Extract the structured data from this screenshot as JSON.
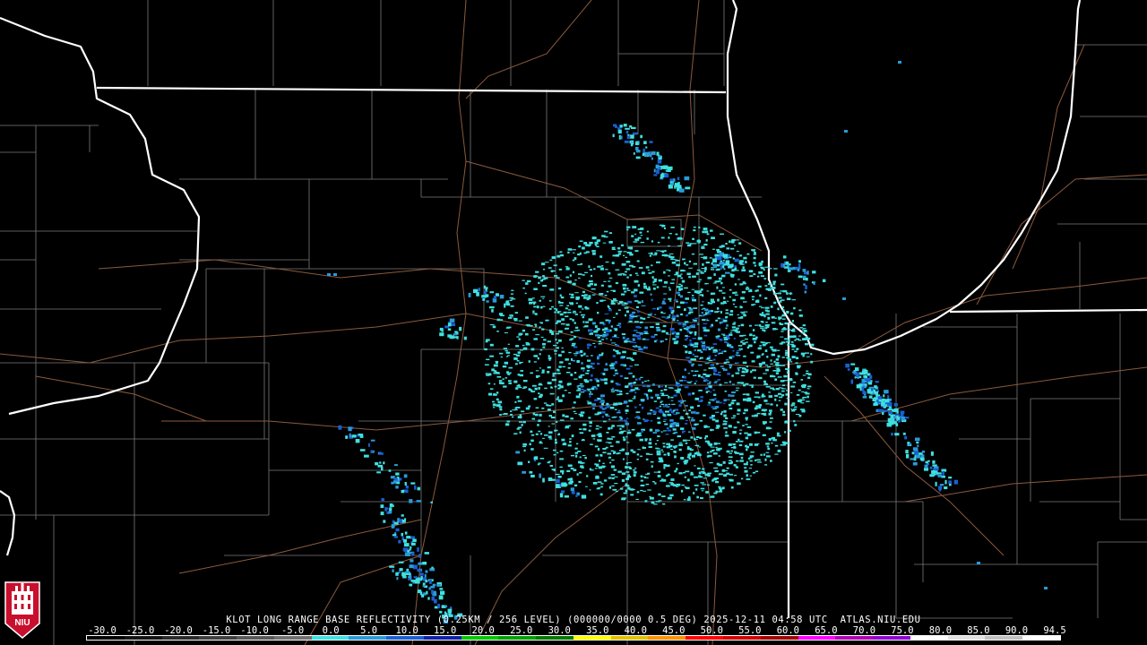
{
  "product_caption": "KLOT LONG RANGE BASE REFLECTIVITY (0.25KM / 256 LEVEL) (000000/0000 0.5 DEG) 2025-12-11 04:58 UTC  ATLAS.NIU.EDU",
  "logo_text": "NIU",
  "colorbar": {
    "labels": [
      "-30.0",
      "-25.0",
      "-20.0",
      "-15.0",
      "-10.0",
      "-5.0",
      "0.0",
      "5.0",
      "10.0",
      "15.0",
      "20.0",
      "25.0",
      "30.0",
      "35.0",
      "40.0",
      "45.0",
      "50.0",
      "55.0",
      "60.0",
      "65.0",
      "70.0",
      "75.0",
      "80.0",
      "85.0",
      "90.0",
      "94.5"
    ],
    "colors": [
      "#000000",
      "#141414",
      "#2a2a2a",
      "#404040",
      "#585858",
      "#707070",
      "#40e0e0",
      "#2a9ad8",
      "#1a5fd0",
      "#1020a8",
      "#00c800",
      "#00a000",
      "#007800",
      "#ffff00",
      "#e0c000",
      "#ff9000",
      "#ff0000",
      "#d00000",
      "#a00000",
      "#ff00ff",
      "#b000b0",
      "#9000d0",
      "#ffffff",
      "#e0e0e0",
      "#c0c0c0",
      "#ffffff"
    ]
  },
  "colors": {
    "state_border": "#ffffff",
    "county_line": "#7a7a7a",
    "highway": "#8b5a3c",
    "echo_light": "#3fe0e0",
    "echo_mid": "#2a9ad8",
    "echo_dark": "#1a5fd0"
  }
}
